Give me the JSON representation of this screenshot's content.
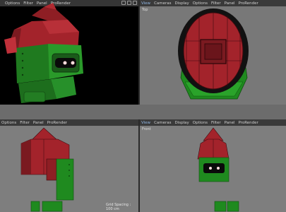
{
  "viewports": {
    "top_left": {
      "menus": [
        "",
        "Options",
        "Filter",
        "Panel",
        "ProRender"
      ]
    },
    "top_right": {
      "menus": [
        "View",
        "Cameras",
        "Display",
        "Options",
        "Filter",
        "Panel",
        "ProRender"
      ],
      "label": "Top"
    },
    "bottom_left": {
      "menus": [
        "Options",
        "Filter",
        "Panel",
        "ProRender"
      ]
    },
    "bottom_right": {
      "menus": [
        "View",
        "Cameras",
        "Display",
        "Options",
        "Filter",
        "Panel",
        "ProRender"
      ],
      "label": "Front"
    }
  },
  "status": {
    "grid_spacing": "Grid Spacing : 100 cm"
  },
  "colors": {
    "helmet_red": "#a3232b",
    "body_green": "#1f8a1f",
    "viewport_gray": "#7e7e7e",
    "menu_active": "#8fb4e0"
  }
}
